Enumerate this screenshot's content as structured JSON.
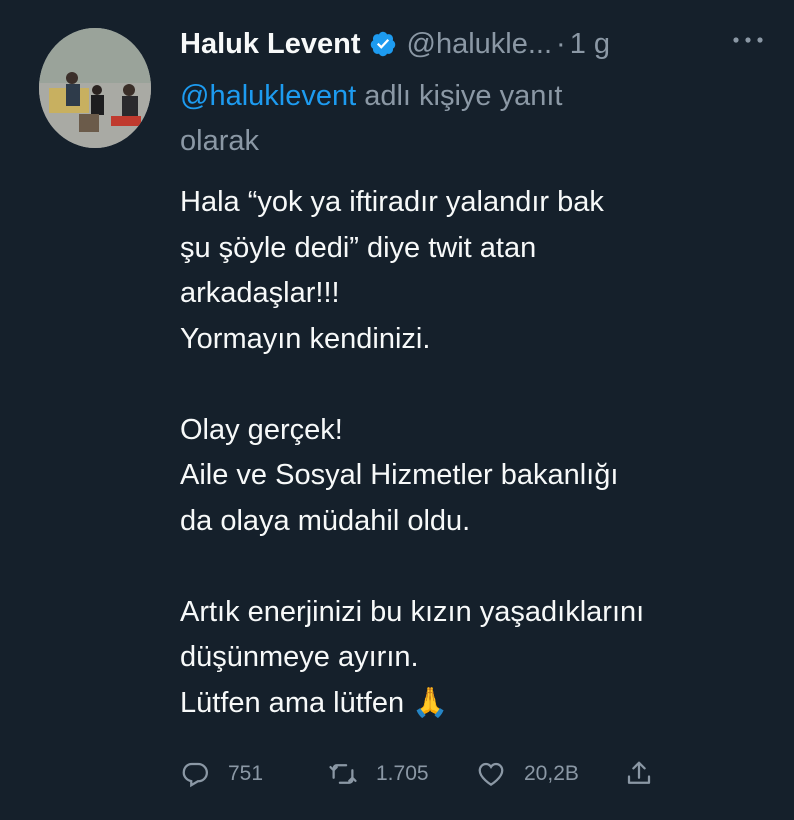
{
  "author": {
    "name": "Haluk Levent",
    "handle": "@halukle...",
    "separator": "·",
    "time": "1 g"
  },
  "reply": {
    "mention": "@haluklevent",
    "text_line1": "adlı kişiye yanıt",
    "text_line2": "olarak"
  },
  "tweet": {
    "lines": [
      "Hala “yok ya iftiradır yalandır bak",
      "şu şöyle dedi” diye twit atan",
      "arkadaşlar!!!",
      "Yormayın kendinizi.",
      "",
      "Olay gerçek!",
      "Aile ve Sosyal Hizmetler bakanlığı",
      "da olaya müdahil oldu.",
      "",
      "Artık enerjinizi bu kızın yaşadıklarını",
      "düşünmeye ayırın.",
      "Lütfen ama lütfen 🙏"
    ]
  },
  "stats": {
    "replies": "751",
    "retweets": "1.705",
    "likes": "20,2B"
  },
  "icons": {
    "verified": "verified-badge-icon",
    "more": "more-options-icon",
    "reply": "reply-icon",
    "retweet": "retweet-icon",
    "like": "like-icon",
    "share": "share-icon"
  },
  "colors": {
    "background": "#15202b",
    "text": "#f7f9f9",
    "muted": "#8b98a5",
    "accent": "#1d9bf0"
  }
}
